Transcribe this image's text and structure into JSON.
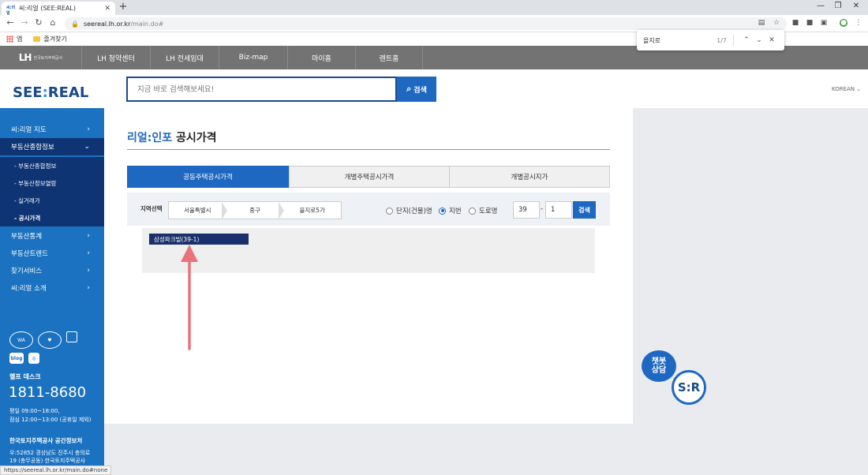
{
  "browser": {
    "tab_title": "씨:리얼 (SEE:REAL)",
    "tab_favicon": "씨:리얼",
    "url_host": "seereal.lh.or.kr",
    "url_path": "/main.do#",
    "bookmarks": [
      "앱",
      "즐겨찾기"
    ],
    "find_query": "을지로",
    "find_count": "1/7",
    "status_url": "https://seereal.lh.or.kr/main.do#none"
  },
  "lh_nav": {
    "logo": "LH",
    "logo_sub": "한국토지주택공사",
    "items": [
      "LH 청약센터",
      "LH 전세임대",
      "Biz-map",
      "마이홈",
      "렌트홈"
    ]
  },
  "header": {
    "logo_left": "SEE",
    "logo_colon": ":",
    "logo_right": "REAL",
    "search_placeholder": "지금 바로 검색해보세요!",
    "search_button": "검색",
    "language": "KOREAN"
  },
  "sidebar": {
    "items": [
      {
        "label": "씨:리얼 지도"
      },
      {
        "label": "부동산종합정보"
      },
      {
        "label": "부동산통계"
      },
      {
        "label": "부동산트렌드"
      },
      {
        "label": "찾기서비스"
      },
      {
        "label": "씨:리얼 소개"
      }
    ],
    "subitems": [
      "- 부동산종합정보",
      "- 부동산정보열람",
      "- 실거래가",
      "- 공시가격"
    ],
    "help_title": "헬프 데스크",
    "phone": "1811-8680",
    "hours_weekday": "평일 09:00~18:00,",
    "hours_lunch": "점심 12:00~13:00 (공휴일 제외)",
    "org_name": "한국토지주택공사 공간정보처",
    "address_line1": "우:52852 경상남도 진주시 충의로",
    "address_line2": "19 (충무공동) 한국토지주택공사",
    "sns": [
      "blog"
    ]
  },
  "main": {
    "title_highlight": "리얼:인포",
    "title_rest": " 공시가격",
    "tabs": [
      "공동주택공시가격",
      "개별주택공시가격",
      "개별공시지가"
    ],
    "active_tab": 0,
    "filter_label": "지역선택",
    "region": [
      "서울특별시",
      "중구",
      "을지로5가"
    ],
    "search_types": [
      "단지(건물)명",
      "지번",
      "도로명"
    ],
    "selected_search_type": 1,
    "lot_main": "39",
    "lot_separator": "-",
    "lot_sub": "1",
    "go_button": "검색",
    "results": [
      "삼성파크빌(39-1)"
    ]
  },
  "chatbot": {
    "label_line1": "챗봇",
    "label_line2": "상담",
    "badge": "S:R"
  },
  "colors": {
    "primary": "#1f68c1",
    "dark_nav": "#0e3473",
    "sidebar": "#1a72c0",
    "arrow": "#e8737a"
  }
}
